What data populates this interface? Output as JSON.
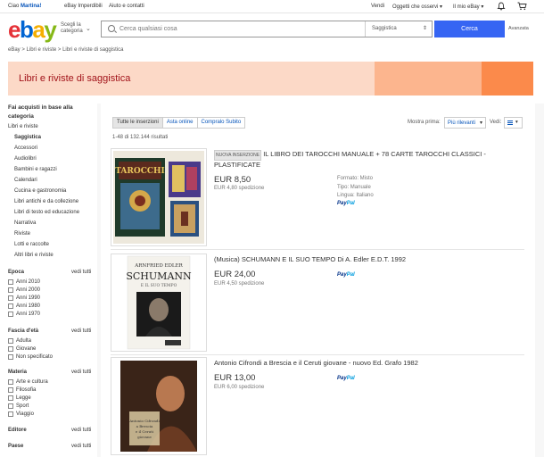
{
  "topbar": {
    "greeting": "Ciao",
    "user": "Martina!",
    "deals": "eBay Imperdibili",
    "help": "Aiuto e contatti",
    "sell": "Vendi",
    "watchlist": "Oggetti che osservi",
    "my_ebay": "Il mio eBay"
  },
  "header": {
    "logo_letters": [
      "e",
      "b",
      "a",
      "y"
    ],
    "category_line1": "Scegli la",
    "category_line2": "categoria",
    "search_placeholder": "Cerca qualsiasi cosa",
    "search_category": "Saggistica",
    "search_button": "Cerca",
    "advanced": "Avanzata"
  },
  "breadcrumb": [
    "eBay",
    "Libri e riviste",
    "Libri e riviste di saggistica"
  ],
  "banner": {
    "title": "Libri e riviste di saggistica"
  },
  "sidebar": {
    "heading": "Fai acquisti in base alla categoria",
    "parent": "Libri e riviste",
    "current": "Saggistica",
    "categories": [
      "Accessori",
      "Audiolibri",
      "Bambini e ragazzi",
      "Calendari",
      "Cucina e gastronomia",
      "Libri antichi e da collezione",
      "Libri di testo ed educazione",
      "Narrativa",
      "Riviste",
      "Lotti e raccolte",
      "Altri libri e riviste"
    ],
    "see_all": "vedi tutti",
    "epoca": {
      "title": "Epoca",
      "options": [
        "Anni 2010",
        "Anni 2000",
        "Anni 1990",
        "Anni 1980",
        "Anni 1970"
      ]
    },
    "fascia": {
      "title": "Fascia d'età",
      "options": [
        "Adulta",
        "Giovane",
        "Non specificato"
      ]
    },
    "materia": {
      "title": "Materia",
      "options": [
        "Arte e cultura",
        "Filosofia",
        "Legge",
        "Sport",
        "Viaggio"
      ]
    },
    "editore": {
      "title": "Editore"
    },
    "paese": {
      "title": "Paese"
    }
  },
  "tabs": [
    "Tutte le inserzioni",
    "Asta online",
    "Compralo Subito"
  ],
  "sort": {
    "label": "Mostra prima:",
    "value": "Più rilevanti",
    "view_label": "Vedi:"
  },
  "results_count": "1-48 di 132.144 risultati",
  "items": [
    {
      "badge": "NUOVA INSERZIONE",
      "title": "IL LIBRO DEI TAROCCHI MANUALE + 78 CARTE TAROCCHI CLASSICI - PLASTIFICATE",
      "price": "EUR 8,50",
      "shipping": "EUR 4,80 spedizione",
      "attributes": [
        "Formato: Misto",
        "Tipo: Manuale",
        "Lingua: Italiano"
      ],
      "paypal": [
        "Pay",
        "Pal"
      ],
      "cover_text": "TAROCCHI"
    },
    {
      "badge": "",
      "title": "(Musica) SCHUMANN E IL SUO TEMPO Di A. Edler E.D.T. 1992",
      "price": "EUR 24,00",
      "shipping": "EUR 4,50 spedizione",
      "attributes": [],
      "paypal": [
        "Pay",
        "Pal"
      ],
      "cover_author": "ARNFRIED EDLER",
      "cover_title": "SCHUMANN",
      "cover_sub": "E IL SUO TEMPO"
    },
    {
      "badge": "",
      "title": "Antonio Cifrondi a Brescia e il Ceruti giovane - nuovo Ed. Grafo 1982",
      "price": "EUR 13,00",
      "shipping": "EUR 6,00 spedizione",
      "attributes": [],
      "paypal": [
        "Pay",
        "Pal"
      ],
      "cover_text": "Antonio Cifrondi a Brescia e il Ceruti giovane"
    }
  ]
}
